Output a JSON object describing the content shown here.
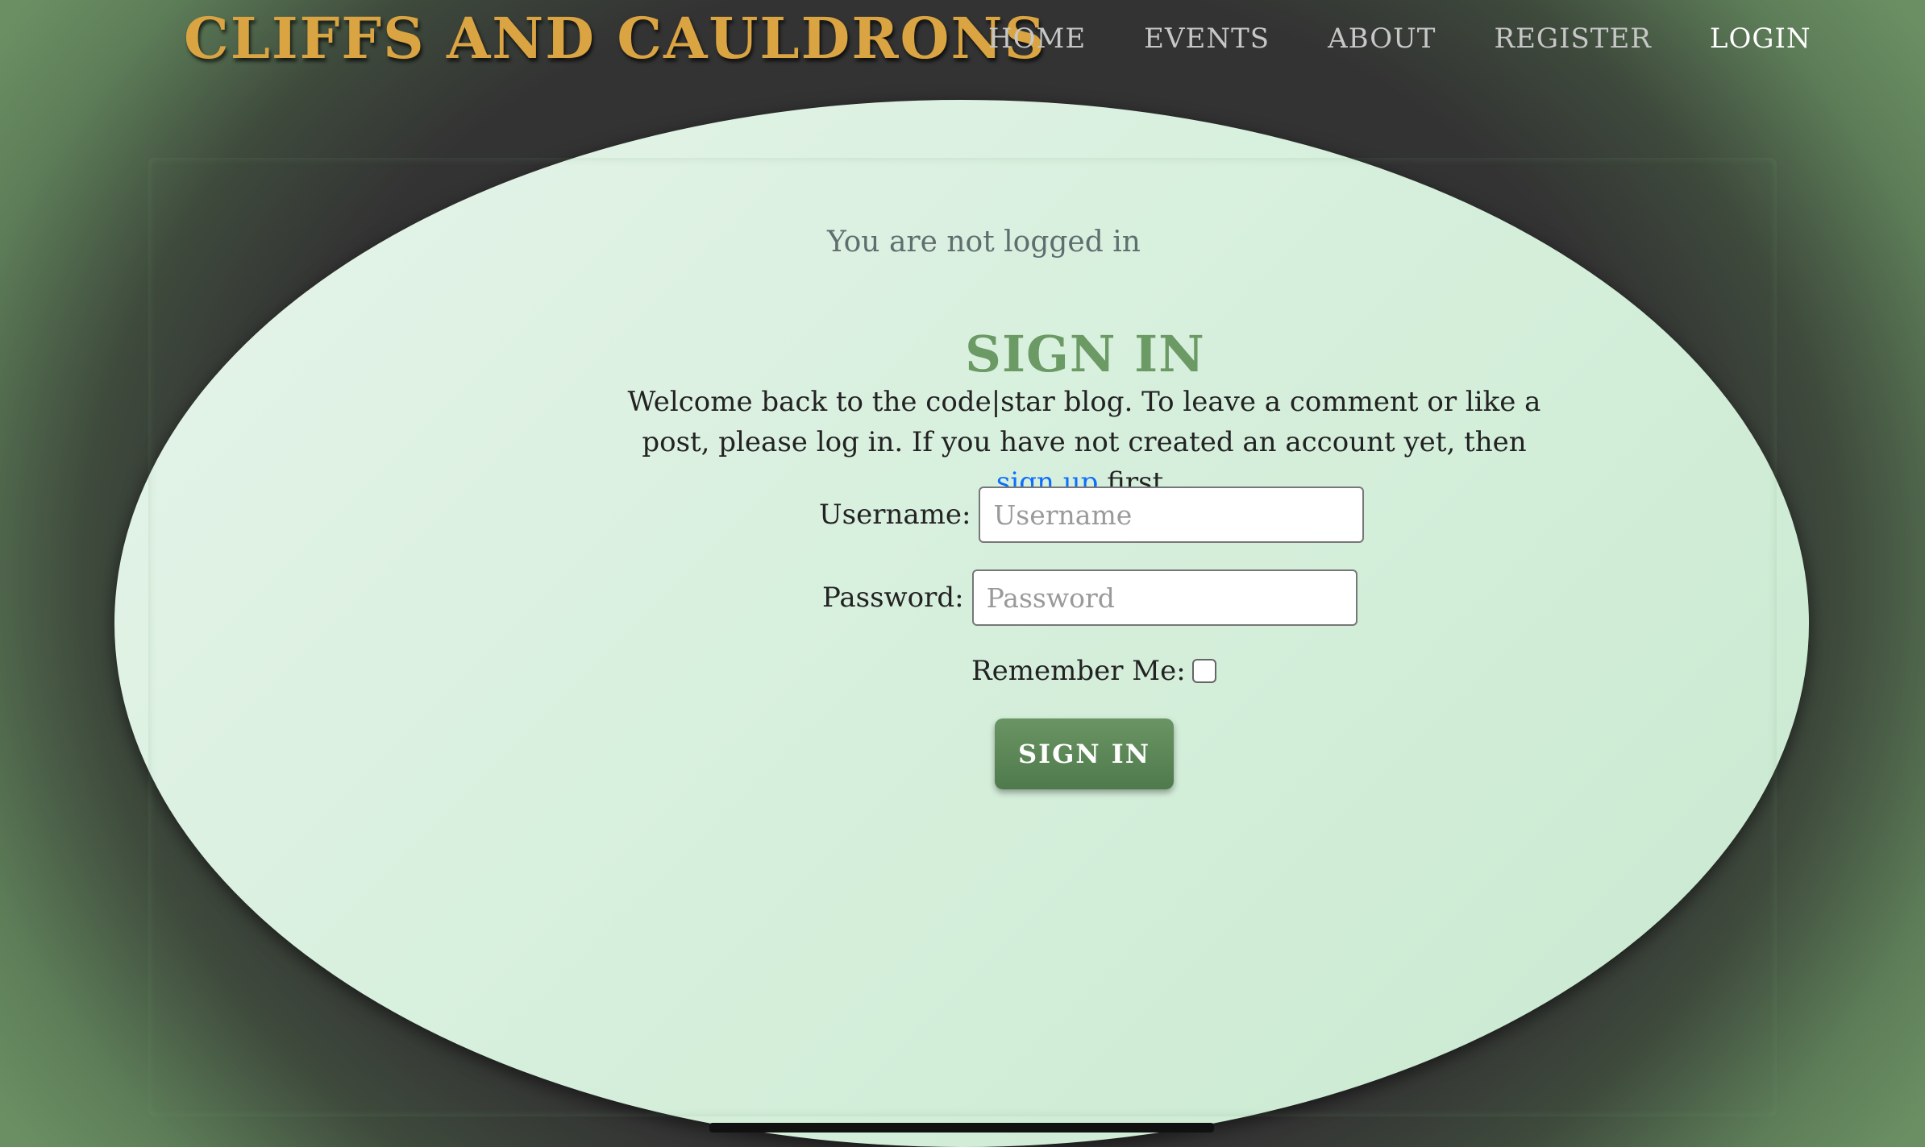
{
  "brand": {
    "title": "Cliffs and Cauldrons"
  },
  "nav": {
    "items": [
      {
        "label": "Home",
        "active": false
      },
      {
        "label": "Events",
        "active": false
      },
      {
        "label": "About",
        "active": false
      },
      {
        "label": "Register",
        "active": false
      },
      {
        "label": "Login",
        "active": true
      }
    ]
  },
  "status": {
    "text": "You are not logged in"
  },
  "login": {
    "heading": "Sign In",
    "intro_before": "Welcome back to the code|star blog. To leave a comment or like a post, please log in. If you have not created an account yet, then ",
    "signup_link": "sign up",
    "intro_after": " first.",
    "username_label": "Username:",
    "username_placeholder": "Username",
    "username_value": "",
    "password_label": "Password:",
    "password_placeholder": "Password",
    "password_value": "",
    "remember_label": "Remember Me:",
    "remember_checked": false,
    "submit_label": "Sign In"
  },
  "colors": {
    "brand": "#d9a441",
    "accent": "#6b9a65",
    "link": "#0d6efd",
    "card": "#d6efdc",
    "page_dark": "#333333",
    "page_green": "#6b8f63"
  }
}
